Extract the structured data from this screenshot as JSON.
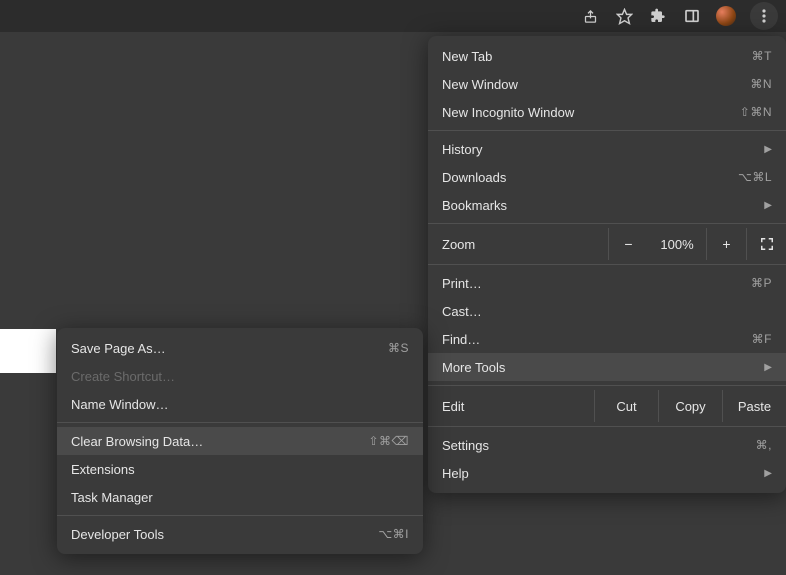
{
  "toolbar": {
    "icons": {
      "share": "share-icon",
      "star": "star-icon",
      "extensions": "puzzle-icon",
      "panel": "sidepanel-icon",
      "avatar": "avatar",
      "menu": "kebab-menu-icon"
    }
  },
  "main_menu": {
    "new_tab": {
      "label": "New Tab",
      "shortcut": "⌘T"
    },
    "new_window": {
      "label": "New Window",
      "shortcut": "⌘N"
    },
    "new_incognito": {
      "label": "New Incognito Window",
      "shortcut": "⇧⌘N"
    },
    "history": {
      "label": "History"
    },
    "downloads": {
      "label": "Downloads",
      "shortcut": "⌥⌘L"
    },
    "bookmarks": {
      "label": "Bookmarks"
    },
    "zoom": {
      "label": "Zoom",
      "level": "100%",
      "minus": "−",
      "plus": "+"
    },
    "print": {
      "label": "Print…",
      "shortcut": "⌘P"
    },
    "cast": {
      "label": "Cast…"
    },
    "find": {
      "label": "Find…",
      "shortcut": "⌘F"
    },
    "more_tools": {
      "label": "More Tools"
    },
    "edit": {
      "label": "Edit",
      "cut": "Cut",
      "copy": "Copy",
      "paste": "Paste"
    },
    "settings": {
      "label": "Settings",
      "shortcut": "⌘,"
    },
    "help": {
      "label": "Help"
    }
  },
  "submenu": {
    "save_page": {
      "label": "Save Page As…",
      "shortcut": "⌘S"
    },
    "create_shortcut": {
      "label": "Create Shortcut…"
    },
    "name_window": {
      "label": "Name Window…"
    },
    "clear_browsing": {
      "label": "Clear Browsing Data…",
      "shortcut": "⇧⌘⌫"
    },
    "extensions": {
      "label": "Extensions"
    },
    "task_manager": {
      "label": "Task Manager"
    },
    "developer_tools": {
      "label": "Developer Tools",
      "shortcut": "⌥⌘I"
    }
  }
}
